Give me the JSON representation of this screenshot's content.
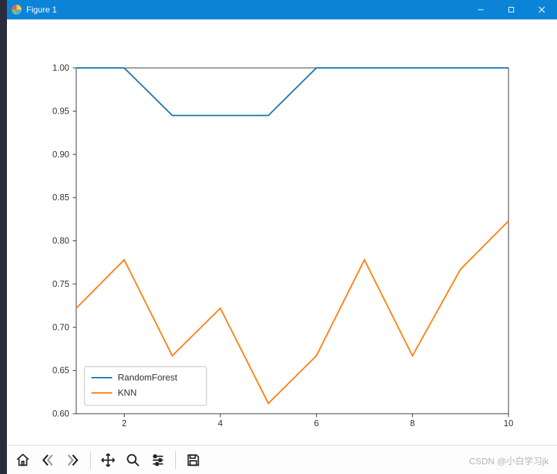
{
  "window": {
    "title": "Figure 1",
    "buttons": {
      "minimize": "–",
      "maximize": "▢",
      "close": "✕"
    }
  },
  "toolbar": {
    "home": "home-icon",
    "back": "back-icon",
    "forward": "forward-icon",
    "pan": "pan-icon",
    "zoom": "zoom-icon",
    "configure": "configure-icon",
    "save": "save-icon"
  },
  "watermark": "CSDN @小白学习jk",
  "chart_data": {
    "type": "line",
    "x": [
      1,
      2,
      3,
      4,
      5,
      6,
      7,
      8,
      9,
      10
    ],
    "series": [
      {
        "name": "RandomForest",
        "color": "#1f77b4",
        "values": [
          1.0,
          1.0,
          0.945,
          0.945,
          0.945,
          1.0,
          1.0,
          1.0,
          1.0,
          1.0
        ]
      },
      {
        "name": "KNN",
        "color": "#ff7f0e",
        "values": [
          0.722,
          0.778,
          0.667,
          0.722,
          0.612,
          0.667,
          0.778,
          0.667,
          0.767,
          0.823
        ]
      }
    ],
    "xlabel": "",
    "ylabel": "",
    "title": "",
    "xlim": [
      1,
      10
    ],
    "ylim": [
      0.6,
      1.0
    ],
    "xticks": [
      2,
      4,
      6,
      8,
      10
    ],
    "yticks": [
      0.6,
      0.65,
      0.7,
      0.75,
      0.8,
      0.85,
      0.9,
      0.95,
      1.0
    ],
    "ytick_labels": [
      "0.60",
      "0.65",
      "0.70",
      "0.75",
      "0.80",
      "0.85",
      "0.90",
      "0.95",
      "1.00"
    ],
    "legend_position": "lower-left"
  }
}
